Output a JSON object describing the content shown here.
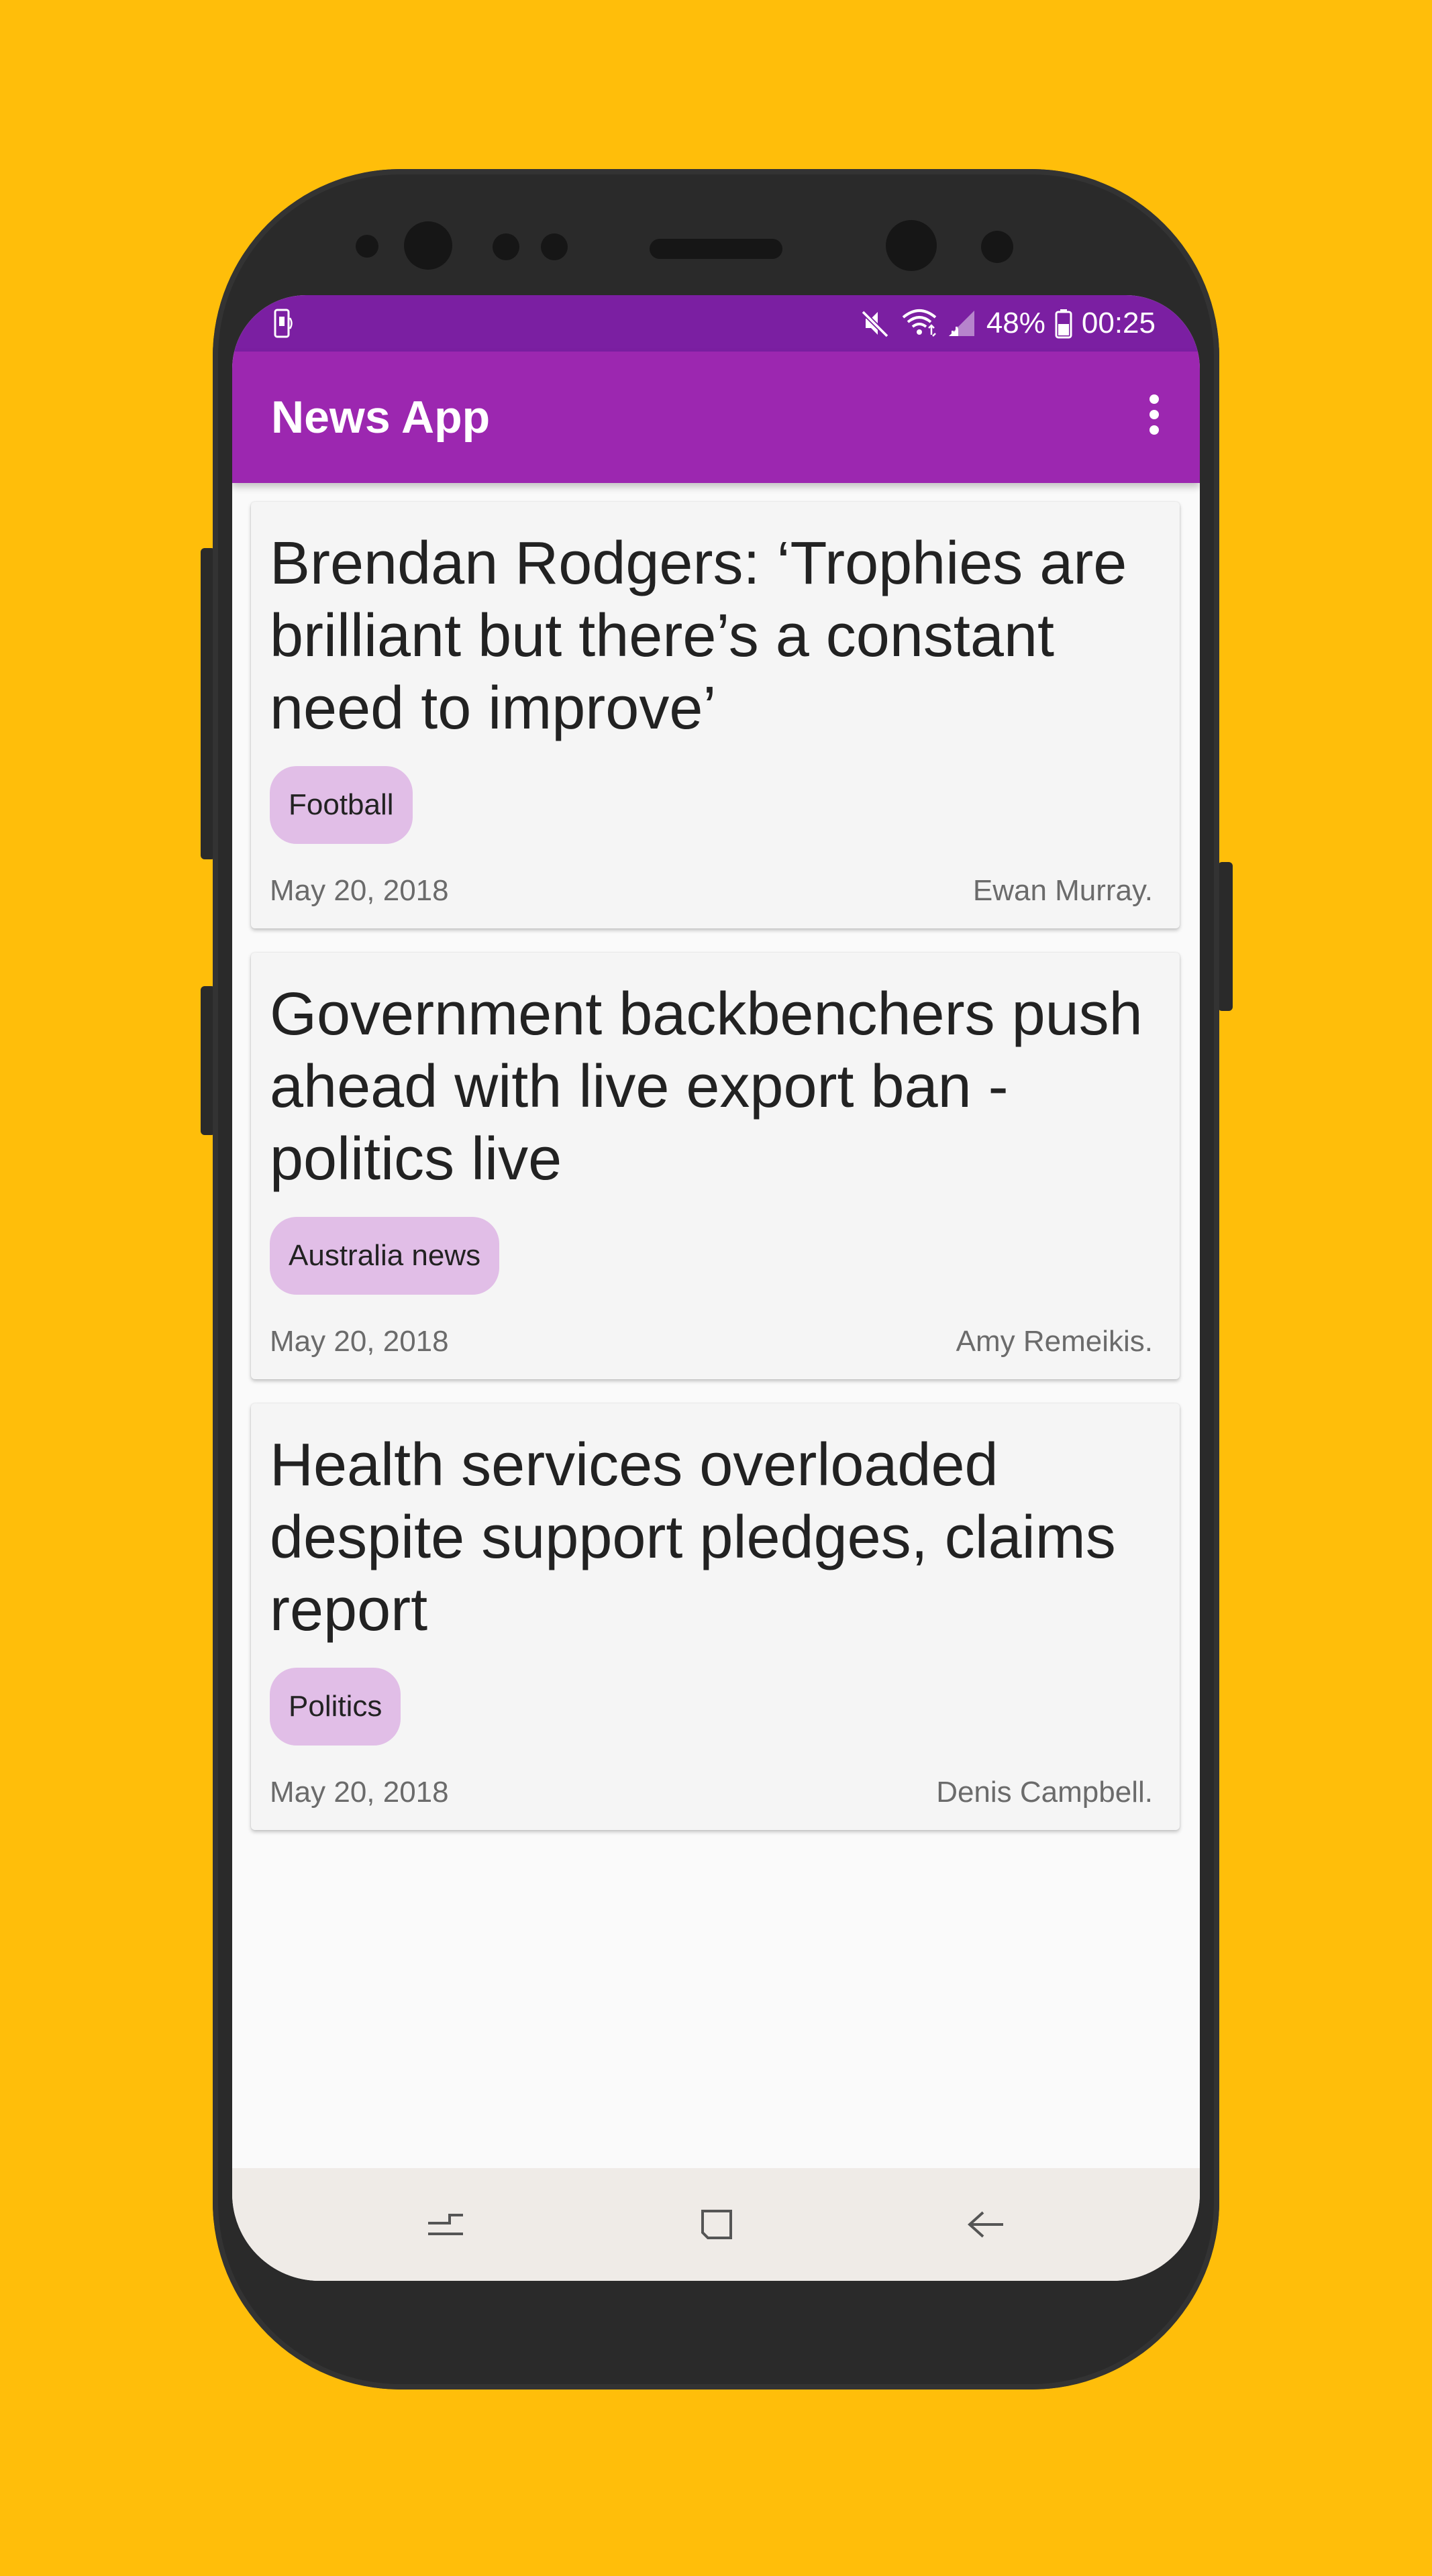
{
  "status_bar": {
    "battery": "48%",
    "time": "00:25",
    "icons": [
      "screen-mirroring-icon",
      "mute-icon",
      "wifi-icon",
      "signal-icon",
      "battery-icon"
    ]
  },
  "app_bar": {
    "title": "News App",
    "menu_icon": "more-vert-icon"
  },
  "articles": [
    {
      "title": "Brendan Rodgers: ‘Trophies are brilliant but there’s a constant need to improve’",
      "section": "Football",
      "date": "May 20, 2018",
      "author": "Ewan Murray."
    },
    {
      "title": "Government backbenchers push ahead with live export ban - politics live",
      "section": "Australia news",
      "date": "May 20, 2018",
      "author": "Amy Remeikis."
    },
    {
      "title": "Health services overloaded despite support pledges, claims report",
      "section": "Politics",
      "date": "May 20, 2018",
      "author": "Denis Campbell."
    }
  ],
  "nav_bar": {
    "icons": [
      "recent-apps-icon",
      "home-icon",
      "back-icon"
    ]
  },
  "colors": {
    "background": "#FFBE0A",
    "status_bar": "#7B1FA2",
    "app_bar": "#9C27B0",
    "chip": "#E1BEE7",
    "card": "#F5F5F5"
  }
}
